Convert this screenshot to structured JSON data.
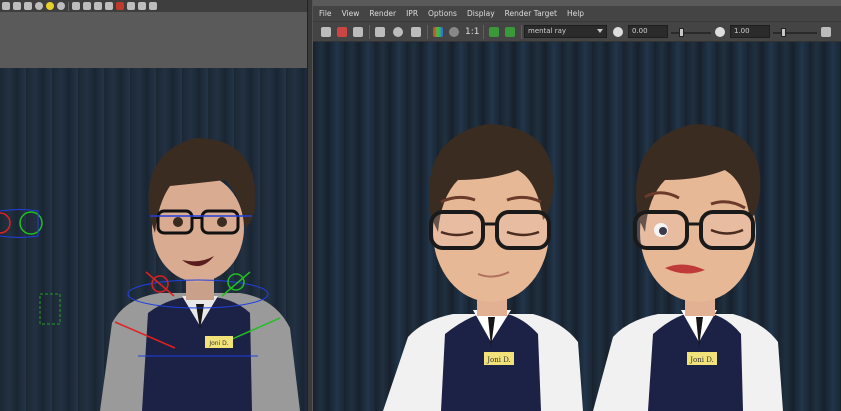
{
  "left_viewport": {
    "hud_text": "",
    "toolbar_icons": [
      "select-icon",
      "cube-icon",
      "checker-icon",
      "sphere-icon",
      "light-icon",
      "camera-icon",
      "grid-icon",
      "frame-icon",
      "snap-icon",
      "isolate-icon"
    ]
  },
  "render_view": {
    "menu": [
      "File",
      "View",
      "Render",
      "IPR",
      "Options",
      "Display",
      "Render Target",
      "Help"
    ],
    "toolbar": {
      "ratio_label": "1:1",
      "renderer": "mental ray",
      "exposure_value": "0.00",
      "gamma_value": "1.00"
    },
    "characters": [
      {
        "badge": "Joni D."
      },
      {
        "badge": "Joni D."
      }
    ]
  },
  "rig_character": {
    "badge": "Joni D."
  },
  "colors": {
    "wall_dark": "#18222e",
    "wall_light": "#22354a",
    "skin": "#e7b896",
    "hair": "#3b2c22",
    "vest": "#1c2146",
    "shirt": "#f1f1f1",
    "badge": "#f2e27a",
    "rig_red": "#e02020",
    "rig_green": "#20c020",
    "rig_blue": "#2040e0"
  }
}
